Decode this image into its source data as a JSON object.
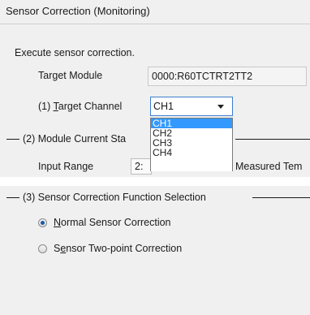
{
  "window": {
    "title": "Sensor Correction (Monitoring)"
  },
  "intro": "Execute sensor correction.",
  "target_module": {
    "label": "Target Module",
    "value": "0000:R60TCTRT2TT2"
  },
  "target_channel": {
    "label_prefix": "(1) ",
    "label_mnemonic": "T",
    "label_rest": "arget Channel",
    "selected": "CH1",
    "options": [
      "CH1",
      "CH2",
      "CH3",
      "CH4"
    ]
  },
  "module_status": {
    "group_label": "(2) Module Current Sta",
    "input_range_label": "Input Range",
    "input_range_value": "2:",
    "measured_label": "Measured Tem"
  },
  "correction_selection": {
    "group_label": "(3) Sensor Correction Function Selection",
    "options": [
      {
        "mnemonic": "N",
        "rest": "ormal Sensor Correction",
        "checked": true
      },
      {
        "prefix": "S",
        "mnemonic": "e",
        "rest": "nsor Two-point Correction",
        "checked": false
      }
    ]
  }
}
